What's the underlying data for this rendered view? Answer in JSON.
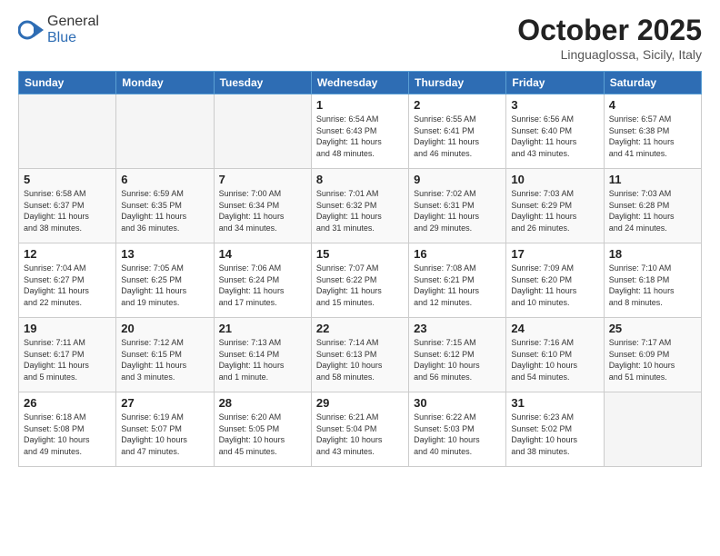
{
  "header": {
    "logo_general": "General",
    "logo_blue": "Blue",
    "month": "October 2025",
    "location": "Linguaglossa, Sicily, Italy"
  },
  "days_of_week": [
    "Sunday",
    "Monday",
    "Tuesday",
    "Wednesday",
    "Thursday",
    "Friday",
    "Saturday"
  ],
  "weeks": [
    [
      {
        "day": "",
        "info": ""
      },
      {
        "day": "",
        "info": ""
      },
      {
        "day": "",
        "info": ""
      },
      {
        "day": "1",
        "info": "Sunrise: 6:54 AM\nSunset: 6:43 PM\nDaylight: 11 hours\nand 48 minutes."
      },
      {
        "day": "2",
        "info": "Sunrise: 6:55 AM\nSunset: 6:41 PM\nDaylight: 11 hours\nand 46 minutes."
      },
      {
        "day": "3",
        "info": "Sunrise: 6:56 AM\nSunset: 6:40 PM\nDaylight: 11 hours\nand 43 minutes."
      },
      {
        "day": "4",
        "info": "Sunrise: 6:57 AM\nSunset: 6:38 PM\nDaylight: 11 hours\nand 41 minutes."
      }
    ],
    [
      {
        "day": "5",
        "info": "Sunrise: 6:58 AM\nSunset: 6:37 PM\nDaylight: 11 hours\nand 38 minutes."
      },
      {
        "day": "6",
        "info": "Sunrise: 6:59 AM\nSunset: 6:35 PM\nDaylight: 11 hours\nand 36 minutes."
      },
      {
        "day": "7",
        "info": "Sunrise: 7:00 AM\nSunset: 6:34 PM\nDaylight: 11 hours\nand 34 minutes."
      },
      {
        "day": "8",
        "info": "Sunrise: 7:01 AM\nSunset: 6:32 PM\nDaylight: 11 hours\nand 31 minutes."
      },
      {
        "day": "9",
        "info": "Sunrise: 7:02 AM\nSunset: 6:31 PM\nDaylight: 11 hours\nand 29 minutes."
      },
      {
        "day": "10",
        "info": "Sunrise: 7:03 AM\nSunset: 6:29 PM\nDaylight: 11 hours\nand 26 minutes."
      },
      {
        "day": "11",
        "info": "Sunrise: 7:03 AM\nSunset: 6:28 PM\nDaylight: 11 hours\nand 24 minutes."
      }
    ],
    [
      {
        "day": "12",
        "info": "Sunrise: 7:04 AM\nSunset: 6:27 PM\nDaylight: 11 hours\nand 22 minutes."
      },
      {
        "day": "13",
        "info": "Sunrise: 7:05 AM\nSunset: 6:25 PM\nDaylight: 11 hours\nand 19 minutes."
      },
      {
        "day": "14",
        "info": "Sunrise: 7:06 AM\nSunset: 6:24 PM\nDaylight: 11 hours\nand 17 minutes."
      },
      {
        "day": "15",
        "info": "Sunrise: 7:07 AM\nSunset: 6:22 PM\nDaylight: 11 hours\nand 15 minutes."
      },
      {
        "day": "16",
        "info": "Sunrise: 7:08 AM\nSunset: 6:21 PM\nDaylight: 11 hours\nand 12 minutes."
      },
      {
        "day": "17",
        "info": "Sunrise: 7:09 AM\nSunset: 6:20 PM\nDaylight: 11 hours\nand 10 minutes."
      },
      {
        "day": "18",
        "info": "Sunrise: 7:10 AM\nSunset: 6:18 PM\nDaylight: 11 hours\nand 8 minutes."
      }
    ],
    [
      {
        "day": "19",
        "info": "Sunrise: 7:11 AM\nSunset: 6:17 PM\nDaylight: 11 hours\nand 5 minutes."
      },
      {
        "day": "20",
        "info": "Sunrise: 7:12 AM\nSunset: 6:15 PM\nDaylight: 11 hours\nand 3 minutes."
      },
      {
        "day": "21",
        "info": "Sunrise: 7:13 AM\nSunset: 6:14 PM\nDaylight: 11 hours\nand 1 minute."
      },
      {
        "day": "22",
        "info": "Sunrise: 7:14 AM\nSunset: 6:13 PM\nDaylight: 10 hours\nand 58 minutes."
      },
      {
        "day": "23",
        "info": "Sunrise: 7:15 AM\nSunset: 6:12 PM\nDaylight: 10 hours\nand 56 minutes."
      },
      {
        "day": "24",
        "info": "Sunrise: 7:16 AM\nSunset: 6:10 PM\nDaylight: 10 hours\nand 54 minutes."
      },
      {
        "day": "25",
        "info": "Sunrise: 7:17 AM\nSunset: 6:09 PM\nDaylight: 10 hours\nand 51 minutes."
      }
    ],
    [
      {
        "day": "26",
        "info": "Sunrise: 6:18 AM\nSunset: 5:08 PM\nDaylight: 10 hours\nand 49 minutes."
      },
      {
        "day": "27",
        "info": "Sunrise: 6:19 AM\nSunset: 5:07 PM\nDaylight: 10 hours\nand 47 minutes."
      },
      {
        "day": "28",
        "info": "Sunrise: 6:20 AM\nSunset: 5:05 PM\nDaylight: 10 hours\nand 45 minutes."
      },
      {
        "day": "29",
        "info": "Sunrise: 6:21 AM\nSunset: 5:04 PM\nDaylight: 10 hours\nand 43 minutes."
      },
      {
        "day": "30",
        "info": "Sunrise: 6:22 AM\nSunset: 5:03 PM\nDaylight: 10 hours\nand 40 minutes."
      },
      {
        "day": "31",
        "info": "Sunrise: 6:23 AM\nSunset: 5:02 PM\nDaylight: 10 hours\nand 38 minutes."
      },
      {
        "day": "",
        "info": ""
      }
    ]
  ]
}
